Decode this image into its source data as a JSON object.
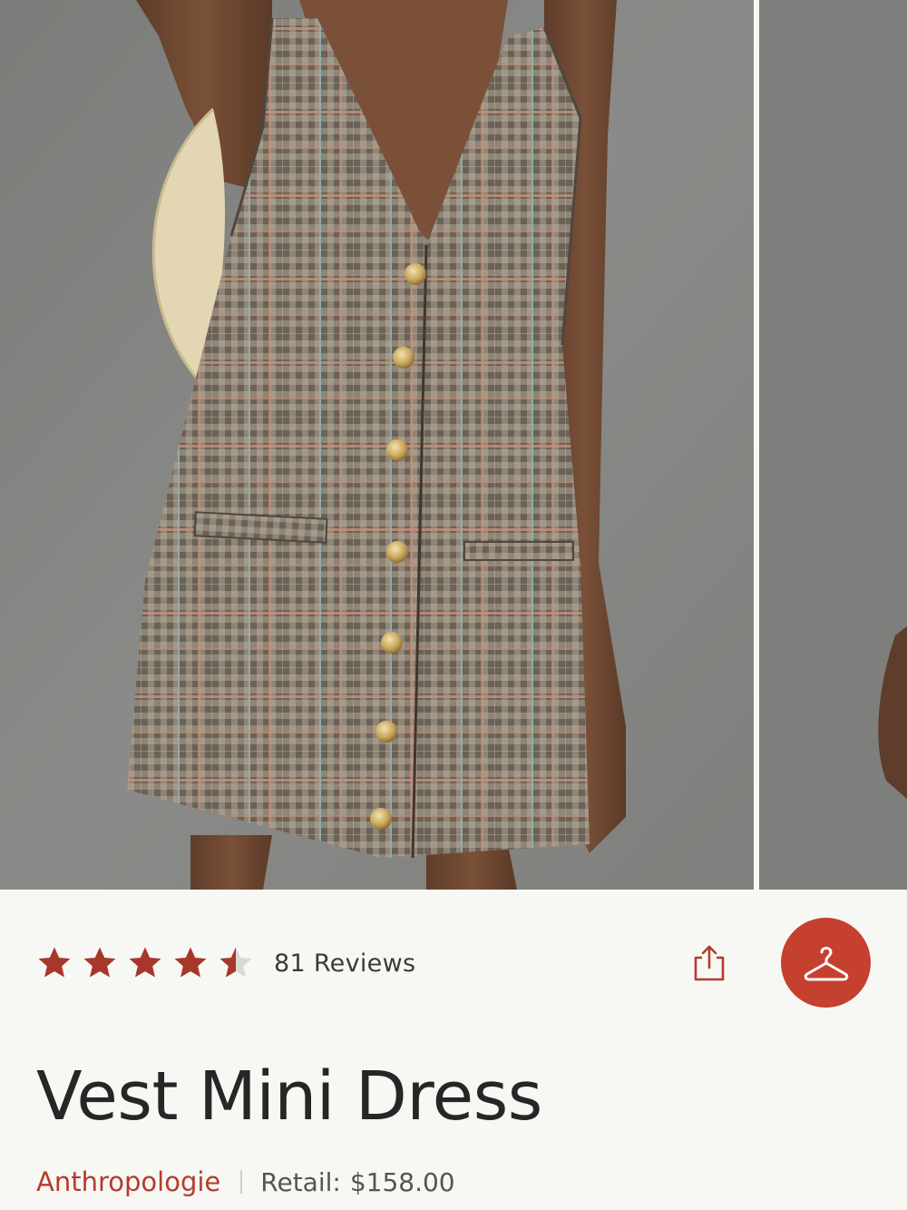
{
  "gallery": {
    "images": [
      {
        "description": "model in plaid vest mini dress, front view",
        "active": true
      },
      {
        "description": "model in plaid vest mini dress, alternate view",
        "active": false
      }
    ]
  },
  "rating": {
    "value": 4.5,
    "max": 5,
    "reviews_label": "81 Reviews",
    "star_color": "#a8372b"
  },
  "actions": {
    "share_icon": "share-icon",
    "closet_icon": "hanger-icon",
    "closet_color": "#c5402f"
  },
  "product": {
    "title": "Vest Mini Dress",
    "brand": "Anthropologie",
    "retail_label": "Retail:",
    "retail_price": "$158.00"
  }
}
